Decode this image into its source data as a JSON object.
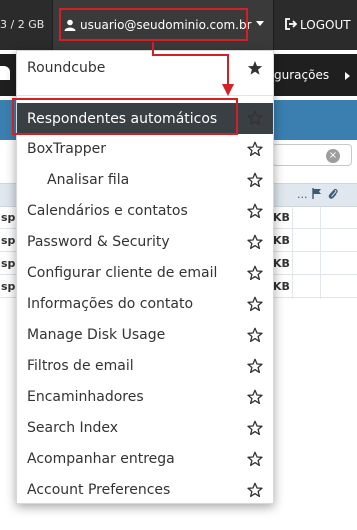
{
  "topbar": {
    "quota_text": "3 / 2 GB",
    "user_email": "usuario@seudominio.com.br",
    "logout_label": "LOGOUT"
  },
  "secondary_bar": {
    "settings_fragment": "gurações"
  },
  "background_table": {
    "rows": [
      {
        "left": "sp",
        "right": "KB"
      },
      {
        "left": "sp",
        "right": "KB"
      },
      {
        "left": "sp",
        "right": "KB"
      },
      {
        "left": "sp",
        "right": "KB"
      }
    ],
    "header_dots": "..."
  },
  "menu": {
    "items": [
      {
        "label": "Roundcube",
        "starred": true
      },
      {
        "label": "Respondentes automáticos",
        "starred": false,
        "active": true
      },
      {
        "label": "BoxTrapper",
        "starred": false
      },
      {
        "label": "Analisar fila",
        "starred": false,
        "sub": true
      },
      {
        "label": "Calendários e contatos",
        "starred": false
      },
      {
        "label": "Password & Security",
        "starred": false
      },
      {
        "label": "Configurar cliente de email",
        "starred": false
      },
      {
        "label": "Informações do contato",
        "starred": false
      },
      {
        "label": "Manage Disk Usage",
        "starred": false
      },
      {
        "label": "Filtros de email",
        "starred": false
      },
      {
        "label": "Encaminhadores",
        "starred": false
      },
      {
        "label": "Search Index",
        "starred": false
      },
      {
        "label": "Acompanhar entrega",
        "starred": false
      },
      {
        "label": "Account Preferences",
        "starred": false
      }
    ]
  },
  "colors": {
    "highlight_red": "#d32027",
    "active_bg": "#3a3f44",
    "topbar_bg": "#2b2b2b"
  }
}
